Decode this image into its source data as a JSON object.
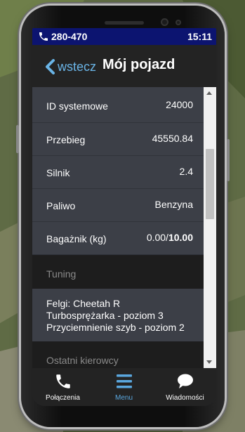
{
  "status": {
    "phone_number": "280-470",
    "time": "15:11"
  },
  "header": {
    "back_label": "wstecz",
    "title": "Mój pojazd"
  },
  "details": [
    {
      "label": "ID systemowe",
      "value": "24000"
    },
    {
      "label": "Przebieg",
      "value": "45550.84"
    },
    {
      "label": "Silnik",
      "value": "2.4"
    },
    {
      "label": "Paliwo",
      "value": "Benzyna"
    },
    {
      "label": "Bagażnik (kg)",
      "value_current": "0.00/",
      "value_max": "10.00"
    }
  ],
  "tuning": {
    "heading": "Tuning",
    "items": [
      "Felgi: Cheetah R",
      "Turbosprężarka - poziom 3",
      "Przyciemnienie szyb - poziom 2"
    ]
  },
  "drivers": {
    "heading": "Ostatni kierowcy"
  },
  "tabs": [
    {
      "label": "Połączenia",
      "icon": "phone-icon",
      "active": false
    },
    {
      "label": "Menu",
      "icon": "menu-icon",
      "active": true
    },
    {
      "label": "Wiadomości",
      "icon": "chat-bubble-icon",
      "active": false
    }
  ],
  "colors": {
    "status_bar": "#0c1470",
    "accent": "#5aa7de",
    "row_background": "#3c3f47",
    "section_background": "#1d1d1d"
  }
}
